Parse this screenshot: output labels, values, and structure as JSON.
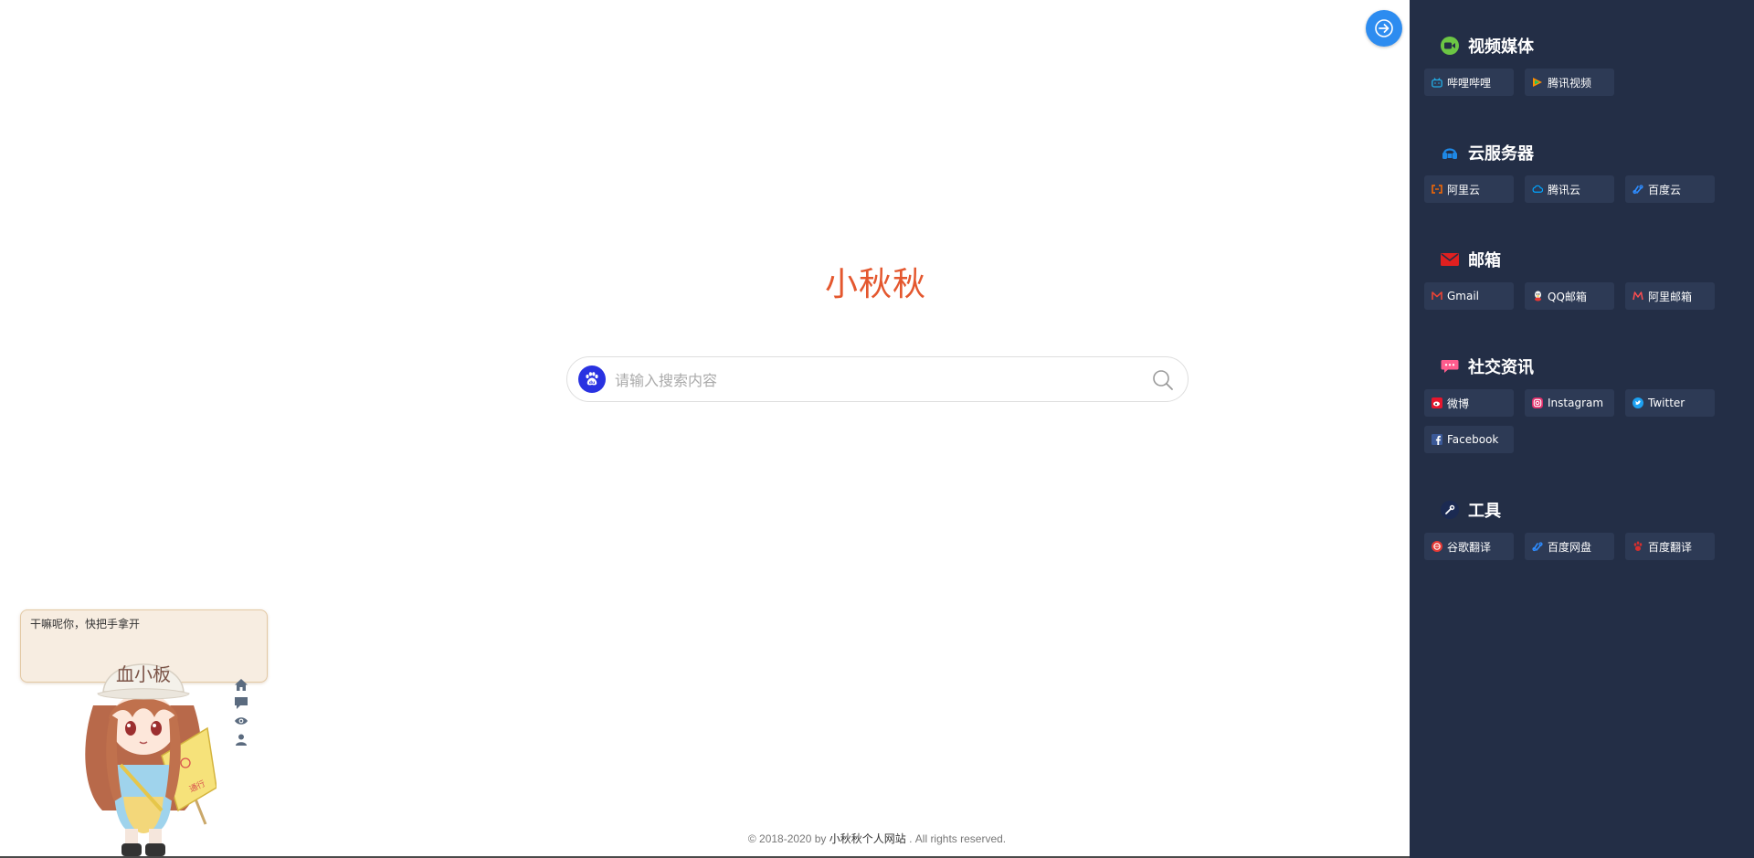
{
  "brand": {
    "title": "小秋秋"
  },
  "search": {
    "placeholder": "请输入搜索内容",
    "engine_icon": "baidu-paw-icon",
    "button_icon": "search-icon"
  },
  "footer": {
    "prefix": "© 2018-2020 by ",
    "site_link": "小秋秋个人网站",
    "suffix": " . All rights reserved."
  },
  "toggle": {
    "icon": "arrow-right-icon",
    "color": "#2d8cf0"
  },
  "mascot": {
    "bubble_text": "干嘛呢你，快把手拿开",
    "cap_text": "血小板",
    "tools": [
      "home-icon",
      "chat-icon",
      "eye-icon",
      "user-icon"
    ]
  },
  "sidebar": {
    "background": "#232e46",
    "groups": [
      {
        "title": "视频媒体",
        "icon": "video-icon",
        "icon_color": "#6cc644",
        "links": [
          {
            "label": "哔哩哔哩",
            "icon": "bilibili-icon",
            "color": "#23ade5"
          },
          {
            "label": "腾讯视频",
            "icon": "tencent-video-icon",
            "color": "#ff8c00"
          }
        ]
      },
      {
        "title": "云服务器",
        "icon": "cloud-server-icon",
        "icon_color": "#1e88e5",
        "links": [
          {
            "label": "阿里云",
            "icon": "aliyun-icon",
            "color": "#ff6a00"
          },
          {
            "label": "腾讯云",
            "icon": "tencent-cloud-icon",
            "color": "#00a4ff"
          },
          {
            "label": "百度云",
            "icon": "baidu-cloud-icon",
            "color": "#2e8cff"
          }
        ]
      },
      {
        "title": "邮箱",
        "icon": "mail-icon",
        "icon_color": "#e02020",
        "links": [
          {
            "label": "Gmail",
            "icon": "gmail-icon",
            "color": "#ea4335"
          },
          {
            "label": "QQ邮箱",
            "icon": "qq-mail-icon",
            "color": "#f5c400"
          },
          {
            "label": "阿里邮箱",
            "icon": "ali-mail-icon",
            "color": "#ff4d4f"
          }
        ]
      },
      {
        "title": "社交资讯",
        "icon": "chat-bubble-icon",
        "icon_color": "#ff5c8d",
        "links": [
          {
            "label": "微博",
            "icon": "weibo-icon",
            "color": "#e6162d"
          },
          {
            "label": "Instagram",
            "icon": "instagram-icon",
            "color": "#e1306c"
          },
          {
            "label": "Twitter",
            "icon": "twitter-icon",
            "color": "#1da1f2"
          },
          {
            "label": "Facebook",
            "icon": "facebook-icon",
            "color": "#3b5998"
          }
        ]
      },
      {
        "title": "工具",
        "icon": "tools-icon",
        "icon_color": "#2d6cdf",
        "links": [
          {
            "label": "谷歌翻译",
            "icon": "google-translate-icon",
            "color": "#e53935"
          },
          {
            "label": "百度网盘",
            "icon": "baidu-pan-icon",
            "color": "#2e8cff"
          },
          {
            "label": "百度翻译",
            "icon": "baidu-translate-icon",
            "color": "#d32f2f"
          }
        ]
      }
    ]
  }
}
